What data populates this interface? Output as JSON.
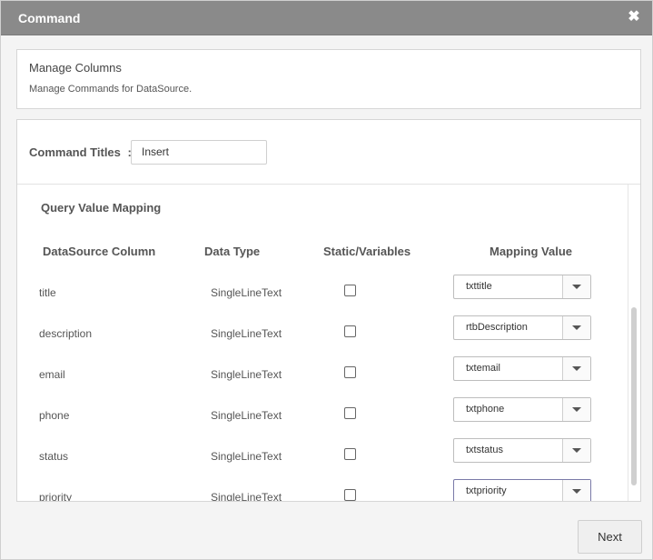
{
  "dialog": {
    "title": "Command",
    "close_glyph": "✖"
  },
  "manage": {
    "heading": "Manage Columns",
    "description": "Manage Commands for DataSource."
  },
  "command": {
    "label": "Command Titles",
    "colon": ":",
    "value": "Insert"
  },
  "mapping": {
    "section_title": "Query Value Mapping",
    "headers": {
      "column": "DataSource Column",
      "type": "Data Type",
      "static": "Static/Variables",
      "value": "Mapping Value"
    },
    "rows": [
      {
        "column": "title",
        "type": "SingleLineText",
        "checked": false,
        "value": "txttitle"
      },
      {
        "column": "description",
        "type": "SingleLineText",
        "checked": false,
        "value": "rtbDescription"
      },
      {
        "column": "email",
        "type": "SingleLineText",
        "checked": false,
        "value": "txtemail"
      },
      {
        "column": "phone",
        "type": "SingleLineText",
        "checked": false,
        "value": "txtphone"
      },
      {
        "column": "status",
        "type": "SingleLineText",
        "checked": false,
        "value": "txtstatus"
      },
      {
        "column": "priority",
        "type": "SingleLineText",
        "checked": false,
        "value": "txtpriority"
      }
    ]
  },
  "footer": {
    "next_label": "Next"
  }
}
